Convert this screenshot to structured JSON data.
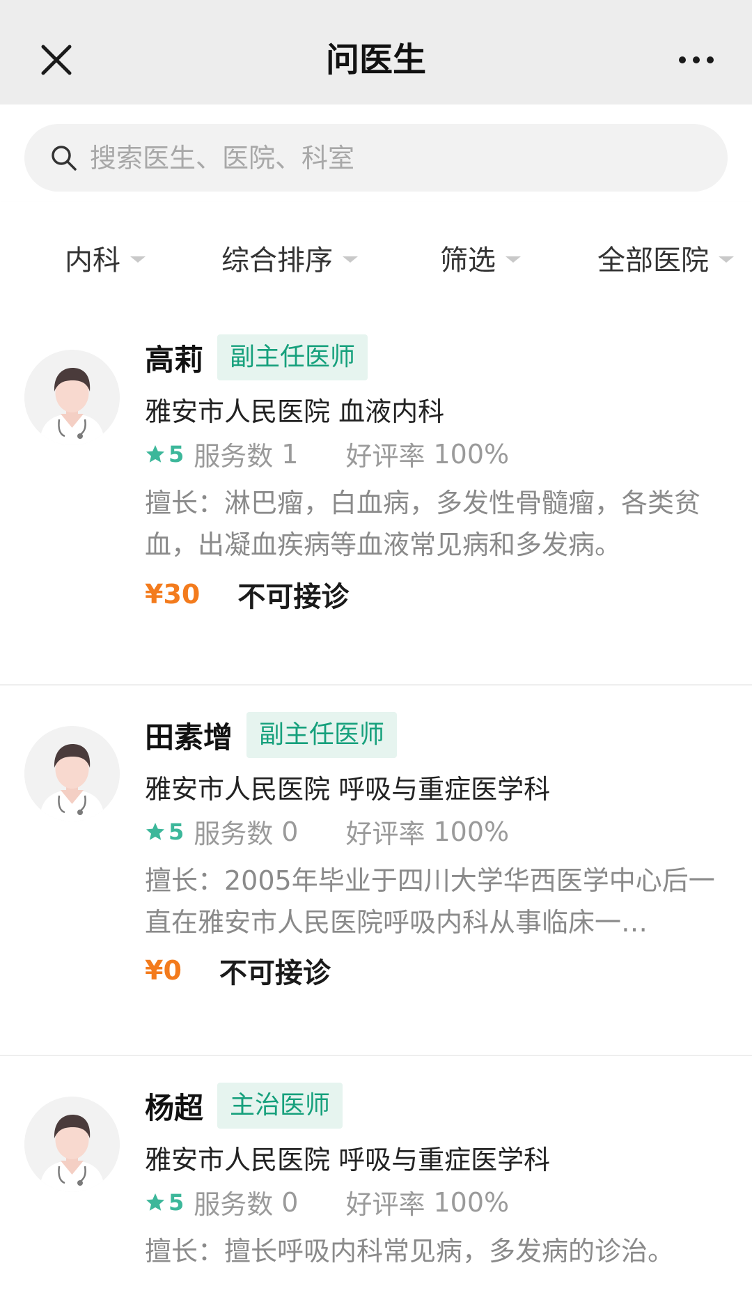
{
  "header": {
    "title": "问医生",
    "close_icon": "close-icon",
    "more_icon": "more-icon"
  },
  "search": {
    "placeholder": "搜索医生、医院、科室",
    "value": "",
    "icon": "search-icon"
  },
  "filters": [
    {
      "label": "内科"
    },
    {
      "label": "综合排序"
    },
    {
      "label": "筛选"
    },
    {
      "label": "全部医院"
    }
  ],
  "doctors": [
    {
      "name": "高莉",
      "title": "副主任医师",
      "hospital": "雅安市人民医院 血液内科",
      "rating": "5",
      "service_label": "服务数",
      "service_count": "1",
      "praise_label": "好评率",
      "praise_rate": "100%",
      "specialty": "擅长：淋巴瘤，白血病，多发性骨髓瘤，各类贫血，出凝血疾病等血液常见病和多发病。",
      "price": "¥30",
      "availability": "不可接诊"
    },
    {
      "name": "田素增",
      "title": "副主任医师",
      "hospital": "雅安市人民医院 呼吸与重症医学科",
      "rating": "5",
      "service_label": "服务数",
      "service_count": "0",
      "praise_label": "好评率",
      "praise_rate": "100%",
      "specialty": "擅长：2005年毕业于四川大学华西医学中心后一直在雅安市人民医院呼吸内科从事临床一…",
      "price": "¥0",
      "availability": "不可接诊"
    },
    {
      "name": "杨超",
      "title": "主治医师",
      "hospital": "雅安市人民医院 呼吸与重症医学科",
      "rating": "5",
      "service_label": "服务数",
      "service_count": "0",
      "praise_label": "好评率",
      "praise_rate": "100%",
      "specialty": "擅长：擅长呼吸内科常见病，多发病的诊治。",
      "price": "",
      "availability": ""
    }
  ],
  "colors": {
    "accent_green": "#3cb79a",
    "title_badge_text": "#16a07c",
    "title_badge_bg": "#e6f4ef",
    "price_orange": "#f37b1d",
    "header_bg": "#ededed"
  }
}
